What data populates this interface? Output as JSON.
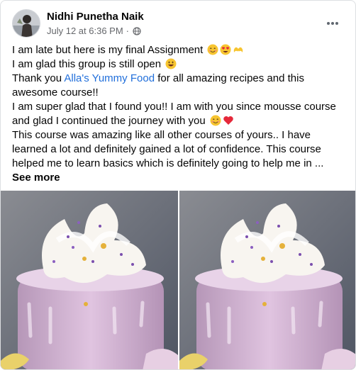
{
  "post": {
    "author": "Nidhi Punetha Naik",
    "date": "July 12 at 6:36 PM",
    "separator": "·",
    "privacy_icon": "globe-icon",
    "menu_icon": "more-options-icon",
    "lines": [
      {
        "text": "I am late but here is my final Assignment",
        "emojis": [
          "smiling-face-icon",
          "heart-eyes-icon",
          "heart-hands-icon"
        ]
      },
      {
        "text": "I am glad this group is still open",
        "emojis": [
          "grinning-face-icon"
        ]
      }
    ],
    "thanks_before": "Thank you ",
    "thanks_link": "Alla's Yummy Food",
    "thanks_after": " for all amazing recipes and this awesome course!!",
    "paragraph_2": "I am super glad that I found you!! I am with you since mousse course and glad I continued the journey with you",
    "paragraph_2_emojis": [
      "smiling-face-icon",
      "red-heart-icon"
    ],
    "paragraph_3": "This course was amazing like all other courses of yours.. I have learned a lot and definitely gained a lot of confidence. This course helped me to learn basics which is definitely going to help me in ...",
    "see_more": "See more",
    "photos": [
      {
        "subject": "cake-photo"
      },
      {
        "subject": "cake-photo"
      }
    ]
  },
  "colors": {
    "link": "#216fdb",
    "secondary_text": "#65676b",
    "cake_pink": "#d9b7d9",
    "background_slate": "#6c7282"
  }
}
